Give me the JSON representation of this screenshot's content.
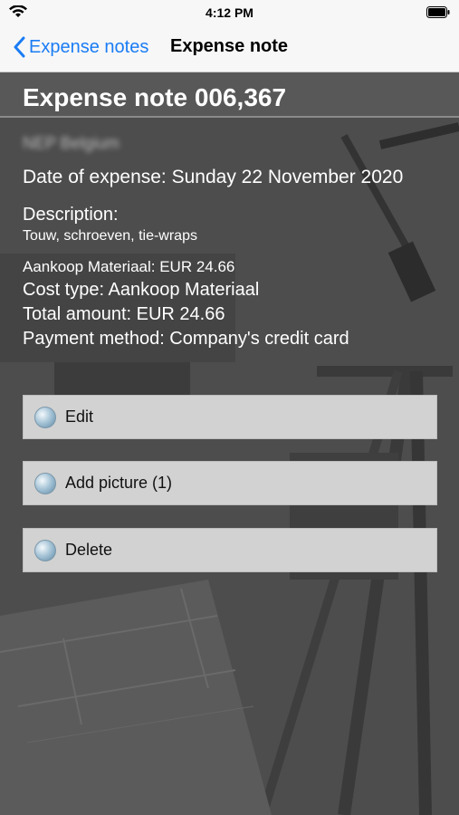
{
  "status_bar": {
    "time": "4:12 PM"
  },
  "nav": {
    "back_label": "Expense notes",
    "title": "Expense note"
  },
  "note": {
    "title": "Expense note 006,367",
    "blurred_company": "NEP Belgium",
    "date": "Date of expense: Sunday 22 November 2020",
    "description_label": "Description:",
    "description_value": "Touw, schroeven, tie-wraps",
    "item_line": "Aankoop Materiaal: EUR 24.66",
    "cost_type": "Cost type: Aankoop Materiaal",
    "total_amount": "Total amount: EUR 24.66",
    "payment_method": "Payment method:  Company's credit card"
  },
  "buttons": {
    "edit": "Edit",
    "add_picture": "Add picture (1)",
    "delete": "Delete"
  }
}
